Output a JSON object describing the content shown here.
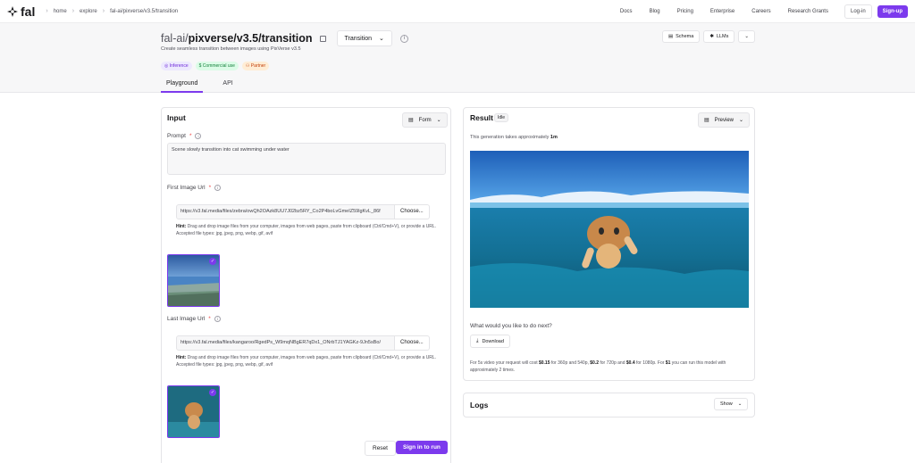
{
  "topbar": {
    "logo_text": "fal",
    "breadcrumbs": [
      "home",
      "explore",
      "fal-ai/pixverse/v3.5/transition"
    ],
    "nav": [
      "Docs",
      "Blog",
      "Pricing",
      "Enterprise",
      "Careers",
      "Research Grants"
    ],
    "login_label": "Log-in",
    "signup_label": "Sign-up"
  },
  "header": {
    "title_prefix": "fal-ai/",
    "title_main": "pixverse/v3.5/transition",
    "variant": "Transition",
    "subtitle": "Create seamless transition between images using PixVerse v3.5",
    "badges": [
      "Inference",
      "Commercial use",
      "Partner"
    ],
    "schema_label": "Schema",
    "llms_label": "LLMs",
    "tabs": [
      "Playground",
      "API"
    ]
  },
  "input": {
    "title": "Input",
    "form_label": "Form",
    "prompt_label": "Prompt",
    "prompt_value": "Scene slowly transition into cat swimming under water",
    "first_label": "First Image Url",
    "first_value": "https://v3.fal.media/files/zebra/owQh2OAzk8UU7J02bz5RY_Co2P4boLvGmeIZ59lgKvL_86f",
    "last_label": "Last Image Url",
    "last_value": "https://v3.fal.media/files/kangaroo/RgedPs_W9mqNBgER7qDx1_ONrbTJ1YAGKz-9Jn5sBo/",
    "choose_label": "Choose...",
    "hint_bold": "Hint:",
    "hint_text": "Drag and drop image files from your computer, images from web pages, paste from clipboard (Ctrl/Cmd+V), or provide a URL. Accepted file types: jpg, jpeg, png, webp, gif, avif",
    "reset_label": "Reset",
    "run_label": "Sign in to run"
  },
  "result": {
    "title": "Result",
    "status": "Idle",
    "preview_label": "Preview",
    "approx_prefix": "This generation takes approximately",
    "approx_value": "1m",
    "next_question": "What would you like to do next?",
    "download_label": "Download",
    "cost_p1": "For 5s video your request will cost",
    "cost_v1": "$0.15",
    "cost_p2": "for 360p and 540p,",
    "cost_v2": "$0.2",
    "cost_p3": "for 720p and",
    "cost_v3": "$0.4",
    "cost_p4": "for 1080p. For",
    "cost_v4": "$1",
    "cost_p5": "you can run this model with approximately 2 times."
  },
  "logs": {
    "title": "Logs",
    "show_label": "Show"
  },
  "colors": {
    "accent": "#7c3aed"
  }
}
